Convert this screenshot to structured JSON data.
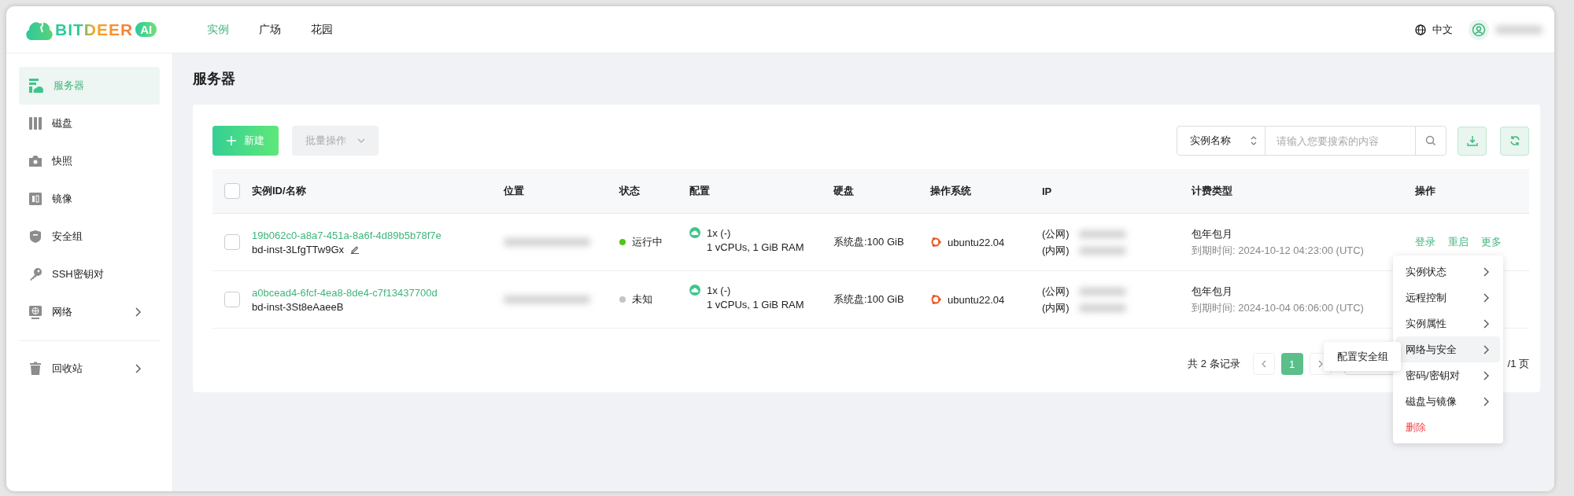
{
  "logo": {
    "text": "BITDEER",
    "badge": "AI"
  },
  "nav": [
    {
      "label": "实例",
      "selected": true
    },
    {
      "label": "广场",
      "selected": false
    },
    {
      "label": "花园",
      "selected": false
    }
  ],
  "header_right": {
    "language": "中文"
  },
  "sidebar": {
    "items": [
      {
        "label": "服务器",
        "selected": true,
        "expandable": false
      },
      {
        "label": "磁盘",
        "selected": false,
        "expandable": false
      },
      {
        "label": "快照",
        "selected": false,
        "expandable": false
      },
      {
        "label": "镜像",
        "selected": false,
        "expandable": false
      },
      {
        "label": "安全组",
        "selected": false,
        "expandable": false
      },
      {
        "label": "SSH密钥对",
        "selected": false,
        "expandable": false
      },
      {
        "label": "网络",
        "selected": false,
        "expandable": true
      }
    ],
    "footer_items": [
      {
        "label": "回收站",
        "selected": false,
        "expandable": true
      }
    ]
  },
  "page_title": "服务器",
  "toolbar": {
    "create_button": "新建",
    "batch_button": {
      "label": "批量操作",
      "disabled": true
    },
    "search": {
      "field": "实例名称",
      "placeholder": "请输入您要搜索的内容"
    }
  },
  "table": {
    "select_all": {
      "checked": false
    },
    "columns": [
      "实例ID/名称",
      "位置",
      "状态",
      "配置",
      "硬盘",
      "操作系统",
      "IP",
      "计费类型",
      "操作"
    ],
    "rows": [
      {
        "checked": false,
        "id": "19b062c0-a8a7-451a-8a6f-4d89b5b78f7e",
        "name": "bd-inst-3LfgTTw9Gx",
        "editable": true,
        "status": "运行中",
        "color": "#52c41a",
        "config": [
          "1x (-)",
          "1 vCPUs, 1 GiB RAM"
        ],
        "disk": "系统盘:100 GiB",
        "os": "ubuntu22.04",
        "ip_labels": [
          "(公网)",
          "(内网)"
        ],
        "billing": "包年包月",
        "expiry": "到期时间: 2024-10-12 04:23:00 (UTC)",
        "actions": [
          "登录",
          "重启",
          "更多"
        ]
      },
      {
        "checked": false,
        "id": "a0bcead4-6fcf-4ea8-8de4-c7f13437700d",
        "name": "bd-inst-3St8eAaeeB",
        "editable": false,
        "status": "未知",
        "color": "#c4c4c4",
        "config": [
          "1x (-)",
          "1 vCPUs, 1 GiB RAM"
        ],
        "disk": "系统盘:100 GiB",
        "os": "ubuntu22.04",
        "ip_labels": [
          "(公网)",
          "(内网)"
        ],
        "billing": "包年包月",
        "expiry": "到期时间: 2024-10-04 06:06:00 (UTC)"
      }
    ]
  },
  "pagination": {
    "total": "共 2 条记录",
    "pages": [
      {
        "label": "1",
        "selected": true
      }
    ],
    "page_count": "/1 页"
  },
  "more_menu": {
    "items": [
      {
        "label": "实例状态",
        "kind": "submenu",
        "selected": false
      },
      {
        "label": "远程控制",
        "kind": "submenu",
        "selected": false
      },
      {
        "label": "实例属性",
        "kind": "submenu",
        "selected": false
      },
      {
        "label": "网络与安全",
        "kind": "submenu",
        "selected": true
      },
      {
        "label": "密码/密钥对",
        "kind": "submenu",
        "selected": false
      },
      {
        "label": "磁盘与镜像",
        "kind": "submenu",
        "selected": false
      },
      {
        "label": "删除",
        "kind": "danger",
        "selected": false
      }
    ]
  },
  "submenu": {
    "items": [
      "配置安全组"
    ]
  }
}
